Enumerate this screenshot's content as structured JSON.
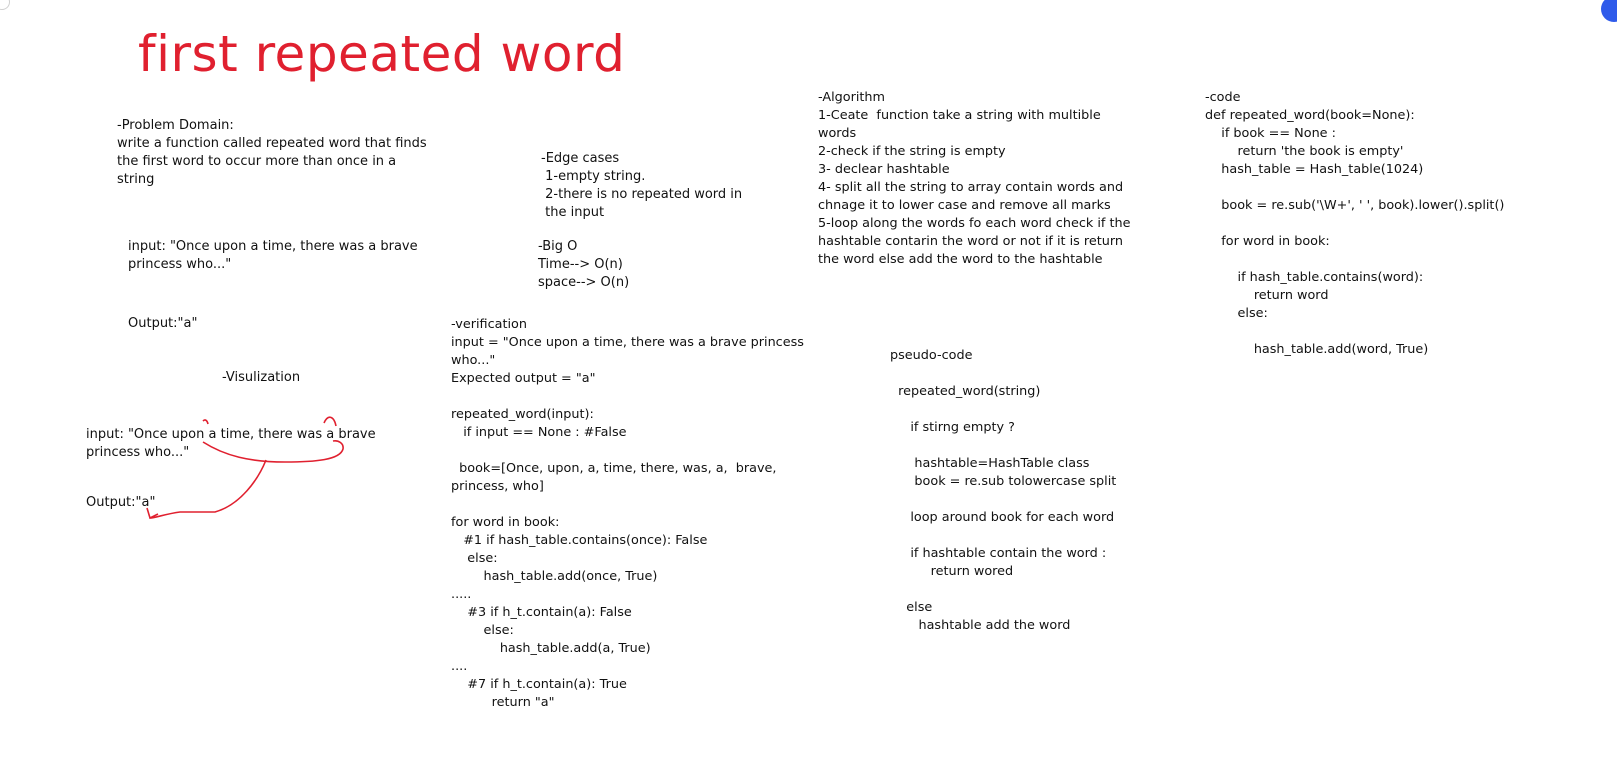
{
  "title": "first repeated word",
  "colors": {
    "ink": "#111111",
    "accent": "#e0202f",
    "corner_button": "#2f5bea"
  },
  "problem_domain": {
    "heading": "-Problem Domain:",
    "text": "write a function called repeated word that finds\nthe first word to occur more than once in a\nstring"
  },
  "example": {
    "input": "input: \"Once upon a time, there was a brave\nprincess who...\"",
    "output": "Output:\"a\""
  },
  "visualization": {
    "heading": "-Visulization",
    "input": "input: \"Once upon a time, there was a brave\nprincess who...\"",
    "output": "Output:\"a\""
  },
  "edge_cases": "-Edge cases\n 1-empty string.\n 2-there is no repeated word in\n the input",
  "big_o": "-Big O\nTime--> O(n)\nspace--> O(n)",
  "verification": "-verification\ninput = \"Once upon a time, there was a brave princess\nwho...\"\nExpected output = \"a\"\n\nrepeated_word(input):\n   if input == None : #False\n\n  book=[Once, upon, a, time, there, was, a,  brave,\nprincess, who]\n\nfor word in book:\n   #1 if hash_table.contains(once): False\n    else:\n        hash_table.add(once, True)\n.....\n    #3 if h_t.contain(a): False\n        else:\n            hash_table.add(a, True)\n....\n    #7 if h_t.contain(a): True\n          return \"a\"",
  "algorithm": "-Algorithm\n1-Ceate  function take a string with multible\nwords\n2-check if the string is empty\n3- declear hashtable\n4- split all the string to array contain words and\nchnage it to lower case and remove all marks\n5-loop along the words fo each word check if the\nhashtable contarin the word or not if it is return\nthe word else add the word to the hashtable",
  "pseudo_code": "pseudo-code\n\n  repeated_word(string)\n\n     if stirng empty ?\n\n      hashtable=HashTable class\n      book = re.sub tolowercase split\n\n     loop around book for each word\n\n     if hashtable contain the word :\n          return wored\n\n    else\n       hashtable add the word",
  "code": "-code\ndef repeated_word(book=None):\n    if book == None :\n        return 'the book is empty'\n    hash_table = Hash_table(1024)\n\n    book = re.sub('\\W+', ' ', book).lower().split()\n\n    for word in book:\n\n        if hash_table.contains(word):\n            return word\n        else:\n\n            hash_table.add(word, True)"
}
